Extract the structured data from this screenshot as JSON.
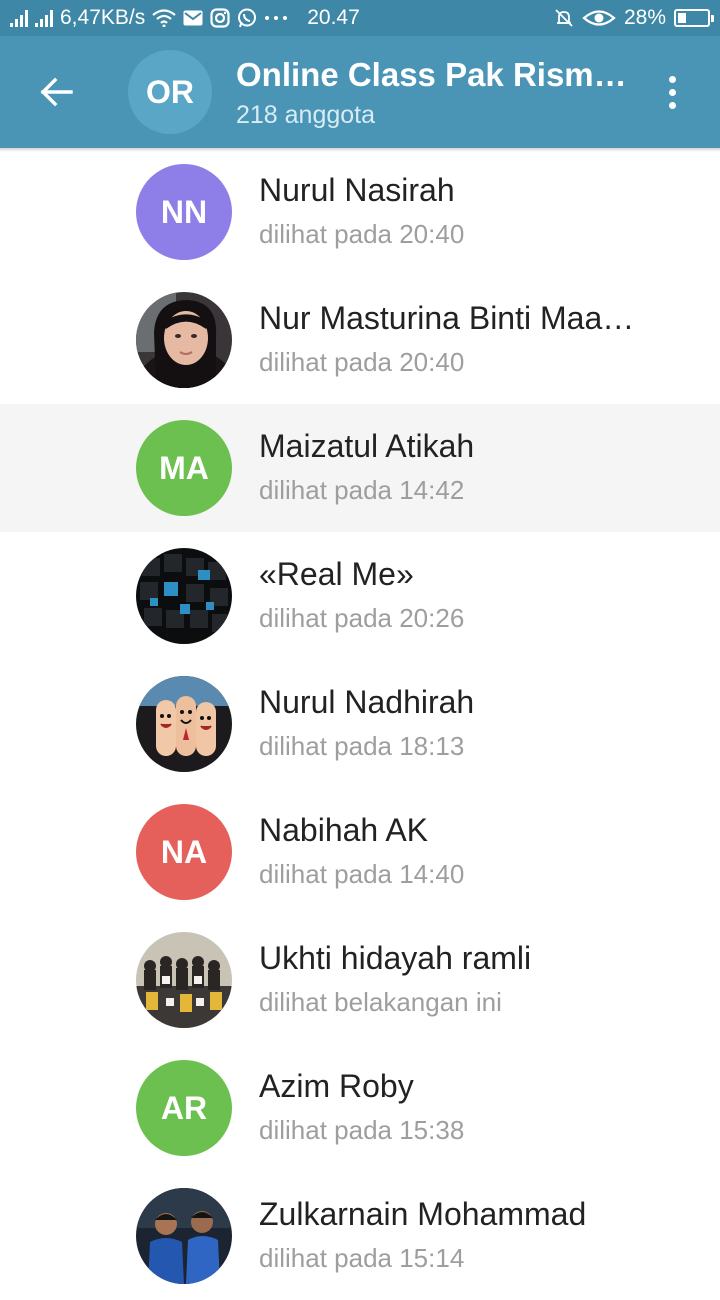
{
  "status_bar": {
    "network_speed": "6,47KB/s",
    "time": "20.47",
    "battery": "28%",
    "battery_level": 0.28,
    "icons": [
      "signal-icon",
      "signal-icon",
      "wifi-icon",
      "gmail-icon",
      "instagram-icon",
      "whatsapp-icon",
      "more-dots-icon",
      "mute-bell-icon",
      "eye-icon",
      "battery-icon"
    ]
  },
  "header": {
    "avatar_initials": "OR",
    "title": "Online Class Pak Rism…",
    "subtitle": "218 anggota",
    "back_icon": "arrow-left-icon",
    "menu_icon": "more-vert-icon"
  },
  "colors": {
    "header": "#4a95b6",
    "status_bar": "#3f87a6",
    "avatar_nn": "#8e7ee8",
    "avatar_ma": "#6cc04f",
    "avatar_na": "#e5605a",
    "avatar_ar": "#6cc04f"
  },
  "members": [
    {
      "name": "Nurul Nasirah",
      "status": "dilihat pada 20:40",
      "initials": "NN",
      "avatar_color": "#8e7ee8"
    },
    {
      "name": "Nur Masturina Binti Maa…",
      "status": "dilihat pada 20:40",
      "initials": "",
      "avatar_type": "photo"
    },
    {
      "name": "Maizatul Atikah",
      "status": "dilihat pada 14:42",
      "initials": "MA",
      "avatar_color": "#6cc04f"
    },
    {
      "name": "«Real Me»",
      "status": "dilihat pada 20:26",
      "initials": "",
      "avatar_type": "photo"
    },
    {
      "name": "Nurul Nadhirah",
      "status": "dilihat pada 18:13",
      "initials": "",
      "avatar_type": "photo"
    },
    {
      "name": "Nabihah AK",
      "status": "dilihat pada 14:40",
      "initials": "NA",
      "avatar_color": "#e5605a"
    },
    {
      "name": "Ukhti hidayah ramli",
      "status": "dilihat belakangan ini",
      "initials": "",
      "avatar_type": "photo"
    },
    {
      "name": "Azim Roby",
      "status": "dilihat pada 15:38",
      "initials": "AR",
      "avatar_color": "#6cc04f"
    },
    {
      "name": "Zulkarnain Mohammad",
      "status": "dilihat pada 15:14",
      "initials": "",
      "avatar_type": "photo"
    }
  ]
}
